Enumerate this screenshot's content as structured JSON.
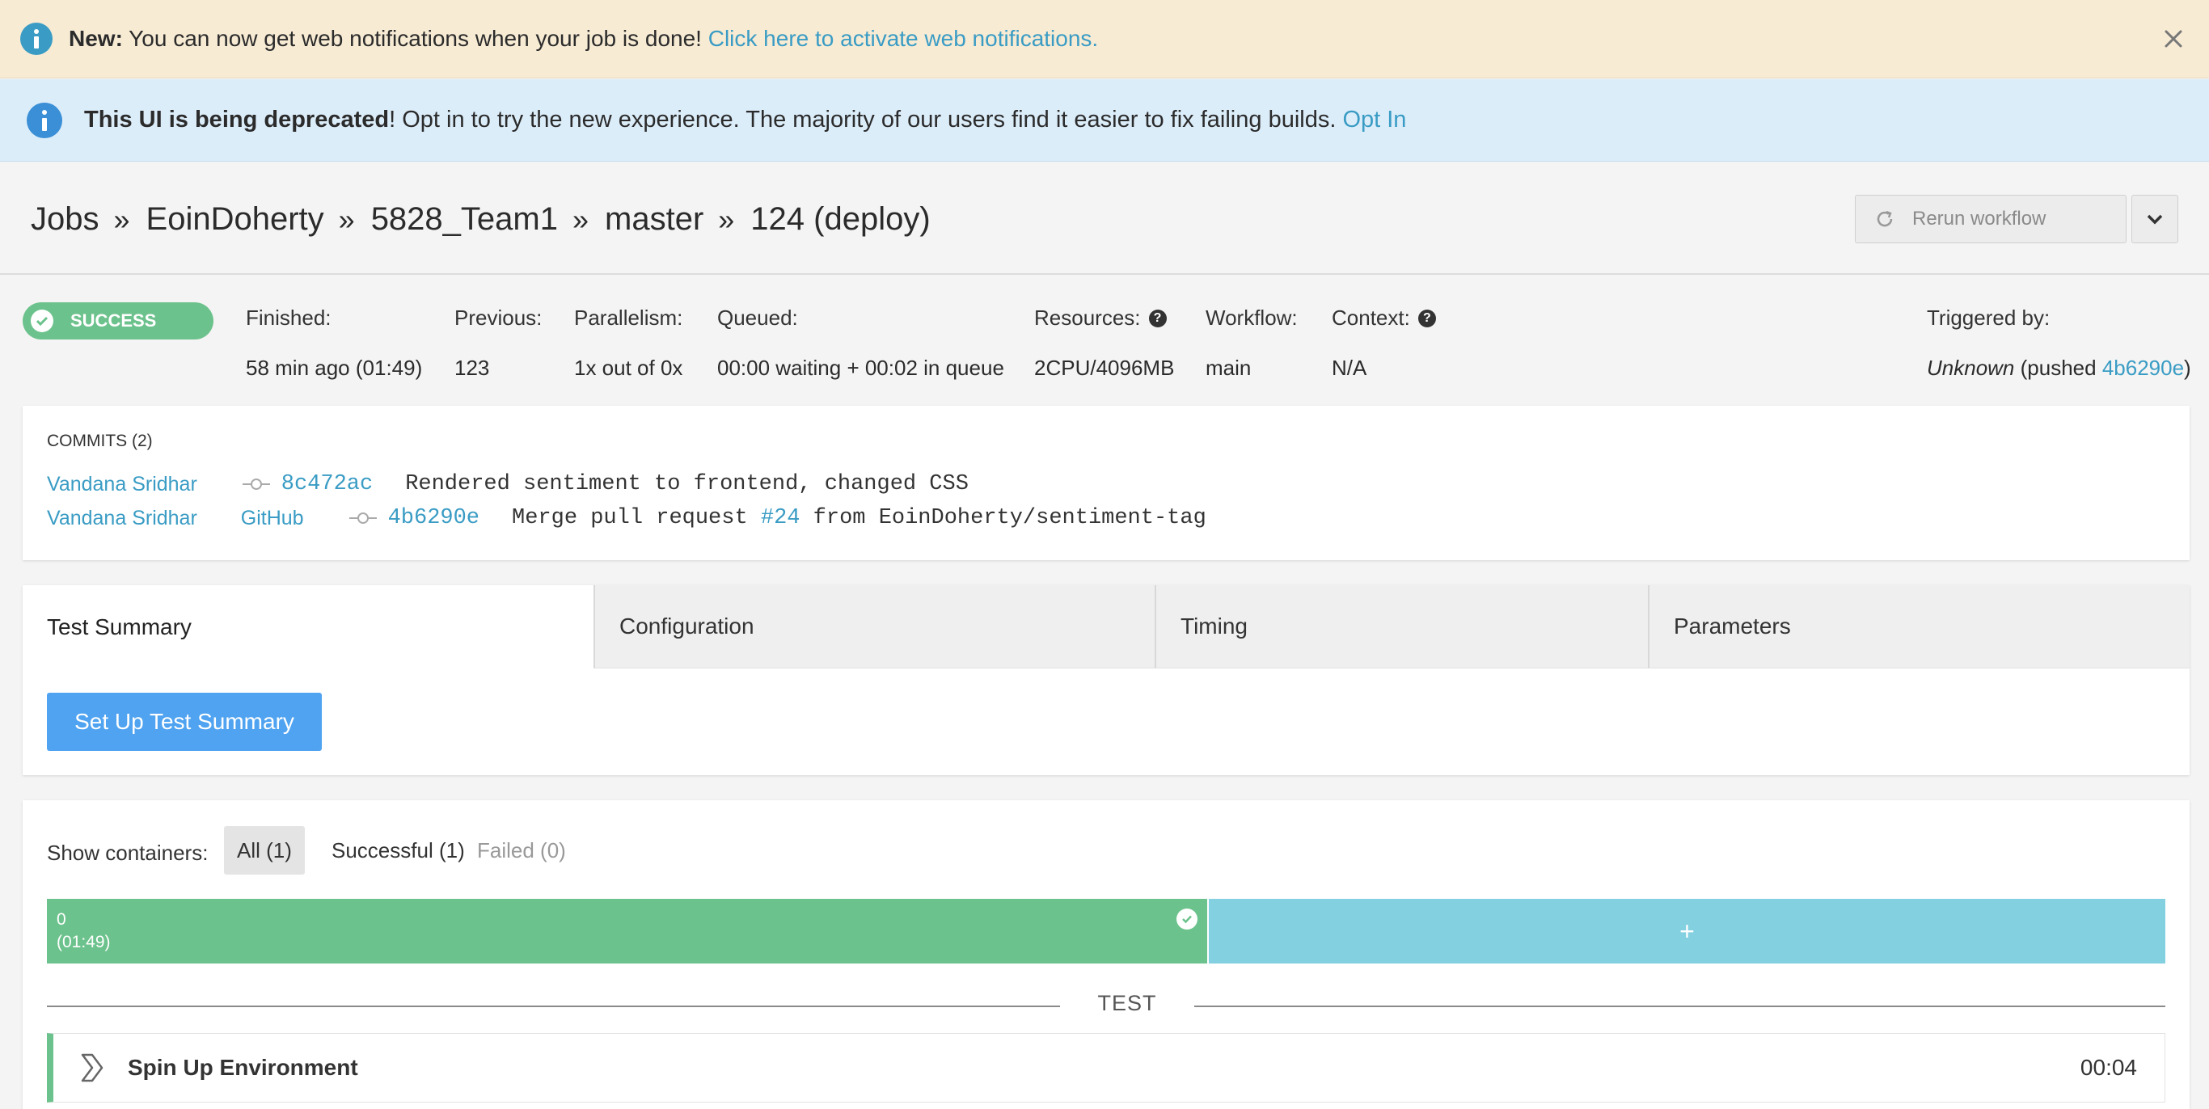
{
  "notify_banner": {
    "bold": "New:",
    "text": " You can now get web notifications when your job is done! ",
    "link": "Click here to activate web notifications."
  },
  "deprecated_banner": {
    "bold": "This UI is being deprecated",
    "text": "! Opt in to try the new experience. The majority of our users find it easier to fix failing builds. ",
    "link": "Opt In"
  },
  "breadcrumb": {
    "items": [
      "Jobs",
      "EoinDoherty",
      "5828_Team1",
      "master",
      "124 (deploy)"
    ],
    "separator": "»"
  },
  "rerun": {
    "label": "Rerun workflow"
  },
  "status": {
    "label": "SUCCESS",
    "color": "#6cc28c"
  },
  "meta": {
    "finished": {
      "label": "Finished:",
      "value": "58 min ago (01:49)"
    },
    "previous": {
      "label": "Previous:",
      "value": "123"
    },
    "parallelism": {
      "label": "Parallelism:",
      "value": "1x out of 0x"
    },
    "queued": {
      "label": "Queued:",
      "value": "00:00 waiting + 00:02 in queue"
    },
    "resources": {
      "label": "Resources:",
      "value": "2CPU/4096MB"
    },
    "workflow": {
      "label": "Workflow:",
      "value": "main"
    },
    "context": {
      "label": "Context:",
      "value": "N/A"
    },
    "triggered": {
      "label": "Triggered by:",
      "who": "Unknown",
      "mid": " (pushed ",
      "sha": "4b6290e",
      "end": ")"
    }
  },
  "commits": {
    "title": "COMMITS (2)",
    "rows": [
      {
        "author": "Vandana Sridhar",
        "committer": "",
        "sha": "8c472ac",
        "msg_pre": "Rendered sentiment to frontend, changed CSS",
        "pr": "",
        "msg_post": ""
      },
      {
        "author": "Vandana Sridhar",
        "committer": "GitHub",
        "sha": "4b6290e",
        "msg_pre": "Merge pull request ",
        "pr": "#24",
        "msg_post": " from EoinDoherty/sentiment-tag"
      }
    ]
  },
  "tabs": [
    "Test Summary",
    "Configuration",
    "Timing",
    "Parameters"
  ],
  "setup_button": "Set Up Test Summary",
  "containers": {
    "show_label": "Show containers:",
    "filters": {
      "all": "All (1)",
      "successful": "Successful (1)",
      "failed": "Failed (0)"
    },
    "bar": {
      "index": "0",
      "duration": "(01:49)"
    },
    "add": "+"
  },
  "section": {
    "label": "TEST"
  },
  "step": {
    "name": "Spin Up Environment",
    "time": "00:04"
  },
  "icons": {
    "info": "info-icon",
    "close": "close-icon",
    "refresh": "refresh-icon",
    "caret": "chevron-down-icon",
    "check": "check-icon",
    "help": "question-icon",
    "commit": "commit-icon",
    "step": "chevron-right-icon"
  }
}
